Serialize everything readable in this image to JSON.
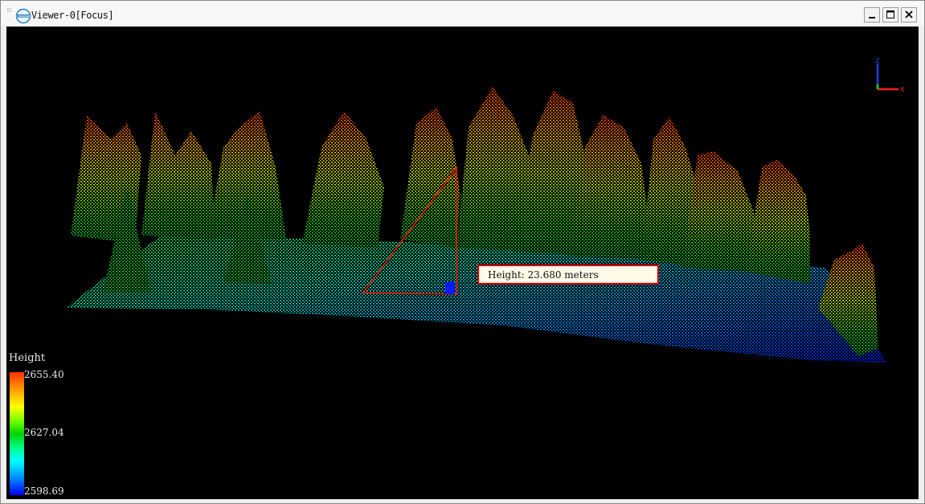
{
  "window": {
    "title": "Viewer-0[Focus]",
    "logo_text": "LiDAR360",
    "controls": {
      "minimize": "minimize-icon",
      "maximize": "maximize-icon",
      "close": "close-icon"
    }
  },
  "viewport": {
    "background": "#000000",
    "measurement": {
      "label": "Height: 23.680 meters",
      "line_color": "#cc1a00",
      "marker_color": "#0a1aff"
    },
    "legend": {
      "title": "Height",
      "max": "2655.40",
      "mid": "2627.04",
      "min": "2598.69",
      "colors": [
        "#ff3000",
        "#ffff00",
        "#00d400",
        "#00ffff",
        "#0000ff"
      ]
    },
    "axis": {
      "x": "X",
      "y": "Y",
      "z": "Z"
    }
  }
}
